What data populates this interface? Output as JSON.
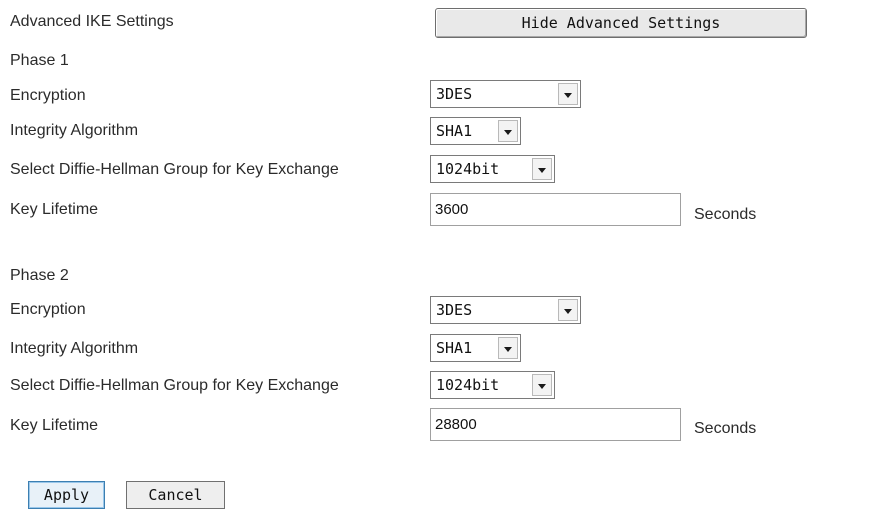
{
  "advanced": {
    "heading": "Advanced IKE Settings",
    "toggle_button_label": "Hide Advanced Settings"
  },
  "phase1": {
    "title": "Phase 1",
    "encryption_label": "Encryption",
    "encryption_value": "3DES",
    "integrity_label": "Integrity Algorithm",
    "integrity_value": "SHA1",
    "dh_label": "Select Diffie-Hellman Group for Key Exchange",
    "dh_value": "1024bit",
    "lifetime_label": "Key Lifetime",
    "lifetime_value": "3600",
    "lifetime_unit": "Seconds"
  },
  "phase2": {
    "title": "Phase 2",
    "encryption_label": "Encryption",
    "encryption_value": "3DES",
    "integrity_label": "Integrity Algorithm",
    "integrity_value": "SHA1",
    "dh_label": "Select Diffie-Hellman Group for Key Exchange",
    "dh_value": "1024bit",
    "lifetime_label": "Key Lifetime",
    "lifetime_value": "28800",
    "lifetime_unit": "Seconds"
  },
  "actions": {
    "apply_label": "Apply",
    "cancel_label": "Cancel"
  },
  "icons": {
    "dropdown": "chevron-down-icon"
  }
}
